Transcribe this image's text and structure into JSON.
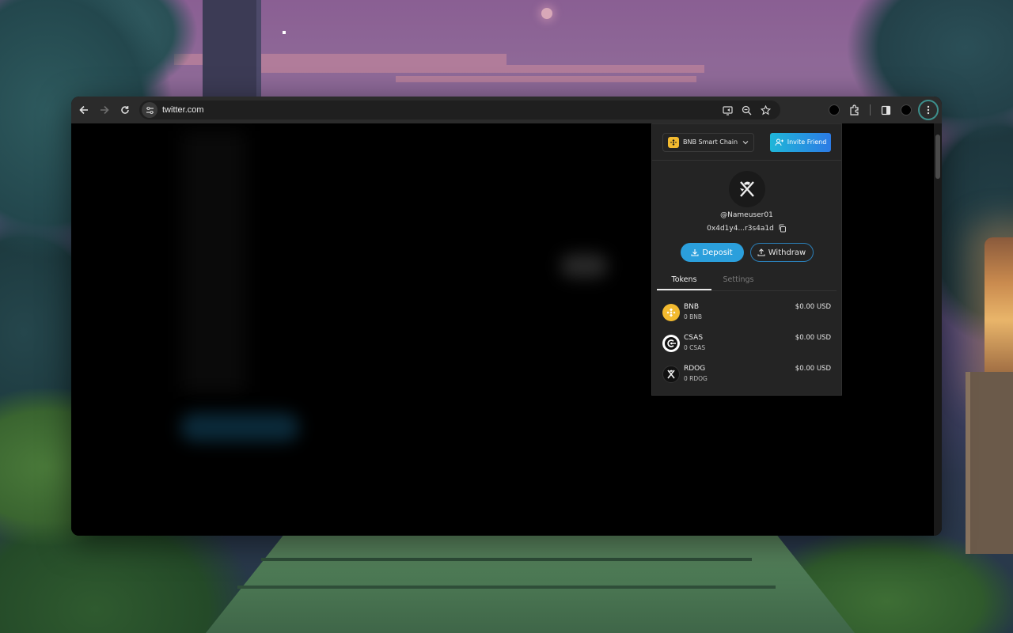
{
  "browser": {
    "url": "twitter.com",
    "nav": {
      "back_icon": "arrow-left-icon",
      "forward_icon": "arrow-right-icon",
      "reload_icon": "reload-icon"
    },
    "omnibox_icons": [
      "cast-icon",
      "zoom-icon",
      "star-icon"
    ],
    "toolbar_icons": [
      "extension-circle-icon",
      "puzzle-icon",
      "side-panel-icon",
      "profile-circle-icon",
      "kebab-menu-icon"
    ]
  },
  "wallet": {
    "chain": {
      "label": "BNB Smart Chain"
    },
    "invite_label": "Invite Friend",
    "profile": {
      "username": "@Nameuser01",
      "address": "0x4d1y4...r3s4a1d"
    },
    "deposit_label": "Deposit",
    "withdraw_label": "Withdraw",
    "tabs": [
      {
        "label": "Tokens",
        "active": true
      },
      {
        "label": "Settings",
        "active": false
      }
    ],
    "tokens": [
      {
        "symbol": "BNB",
        "amount": "0 BNB",
        "value": "$0.00 USD",
        "icon": "bnb-icon"
      },
      {
        "symbol": "CSAS",
        "amount": "0 CSAS",
        "value": "$0.00 USD",
        "icon": "csas-icon"
      },
      {
        "symbol": "RDOG",
        "amount": "0 RDOG",
        "value": "$0.00 USD",
        "icon": "rdog-icon"
      }
    ],
    "colors": {
      "accent": "#2b9fdc",
      "bnb": "#f3ba2f",
      "invite_gradient_start": "#1fb6d8",
      "invite_gradient_end": "#2c7be5"
    }
  }
}
